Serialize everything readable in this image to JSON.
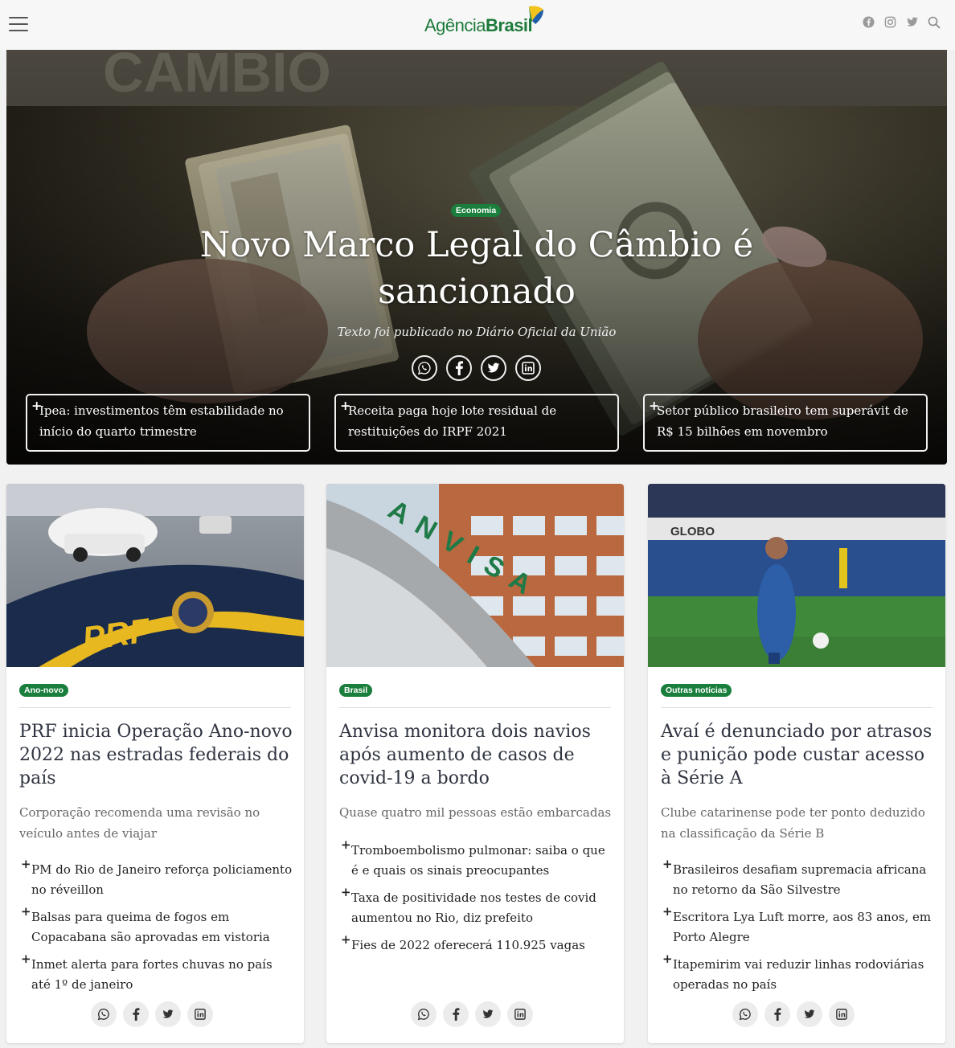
{
  "header": {
    "logo_part1": "Agência",
    "logo_part2": "Brasil",
    "icons": [
      "facebook-icon",
      "instagram-icon",
      "twitter-icon",
      "search-icon"
    ]
  },
  "colors": {
    "accent_green": "#1a7f3c",
    "logo_yellow": "#f0c41b",
    "logo_blue": "#1f5ea8"
  },
  "hero": {
    "tag": "Economia",
    "title": "Novo Marco Legal do Câmbio é sancionado",
    "subtitle": "Texto foi publicado no Diário Oficial da União",
    "share_icons": [
      "whatsapp-icon",
      "facebook-icon",
      "twitter-icon",
      "linkedin-icon"
    ],
    "related": [
      "Ipea: investimentos têm estabilidade no início do quarto trimestre",
      "Receita paga hoje lote residual de restituições do IRPF 2021",
      "Setor público brasileiro tem superávit de R$ 15 bilhões em novembro"
    ]
  },
  "cards": [
    {
      "tag": "Ano-novo",
      "title": "PRF inicia Operação Ano-novo 2022 nas estradas federais do país",
      "description": "Corporação recomenda uma revisão no veículo antes de viajar",
      "links": [
        "PM do Rio de Janeiro reforça policiamento no réveillon",
        "Balsas para queima de fogos em Copacabana são aprovadas em vistoria",
        "Inmet alerta para fortes chuvas no país até 1º de janeiro"
      ],
      "image_text": "PRF"
    },
    {
      "tag": "Brasil",
      "title": "Anvisa monitora dois navios após aumento de casos de covid-19 a bordo",
      "description": "Quase quatro mil pessoas estão embarcadas",
      "links": [
        "Tromboembolismo pulmonar: saiba o que é e quais os sinais preocupantes",
        "Taxa de positividade nos testes de covid aumentou no Rio, diz prefeito",
        "Fies de 2022 oferecerá 110.925 vagas"
      ],
      "image_text": "ANVISA"
    },
    {
      "tag": "Outras notícias",
      "title": "Avaí é denunciado por atrasos e punição pode custar acesso à Série A",
      "description": "Clube catarinense pode ter ponto deduzido na classificação da Série B",
      "links": [
        "Brasileiros desafiam supremacia africana no retorno da São Silvestre",
        "Escritora Lya Luft morre, aos 83 anos, em Porto Alegre",
        "Itapemirim vai reduzir linhas rodoviárias operadas no país"
      ],
      "image_text": "GLOBO"
    }
  ]
}
